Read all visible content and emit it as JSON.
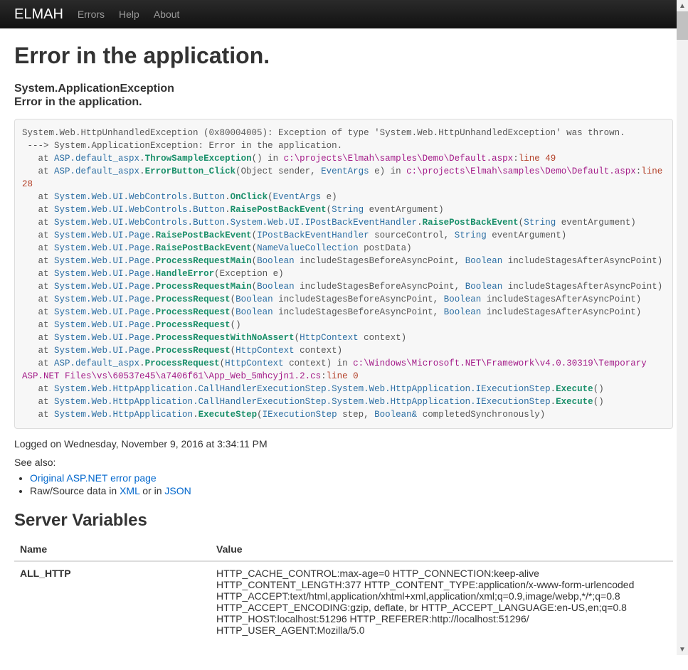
{
  "nav": {
    "brand": "ELMAH",
    "links": [
      "Errors",
      "Help",
      "About"
    ]
  },
  "title": "Error in the application.",
  "exception_type": "System.ApplicationException",
  "exception_msg": "Error in the application.",
  "stack": {
    "l0": "System.Web.HttpUnhandledException (0x80004005): Exception of type 'System.Web.HttpUnhandledException' was thrown.\n ---> System.ApplicationException: Error in the application.",
    "f1": {
      "pre": "   at ",
      "type": "ASP.default_aspx",
      "method": "ThrowSampleException",
      "args": "() in ",
      "file": "c:\\projects\\Elmah\\samples\\Demo\\Default.aspx",
      "line": "line 49"
    },
    "f2": {
      "pre": "   at ",
      "type": "ASP.default_aspx",
      "method": "ErrorButton_Click",
      "args": "(Object sender, ",
      "kw1": "EventArgs",
      "args2": " e) in ",
      "file": "c:\\projects\\Elmah\\samples\\Demo\\Default.aspx",
      "line": "line 28"
    },
    "f3": {
      "pre": "   at ",
      "type": "System.Web.UI.WebControls.Button",
      "method": "OnClick",
      "args": "(",
      "kw1": "EventArgs",
      "args2": " e)"
    },
    "f4": {
      "pre": "   at ",
      "type": "System.Web.UI.WebControls.Button",
      "method": "RaisePostBackEvent",
      "args": "(",
      "kw1": "String",
      "args2": " eventArgument)"
    },
    "f5": {
      "pre": "   at ",
      "type": "System.Web.UI.WebControls.Button.System.Web.UI.IPostBackEventHandler",
      "method": "RaisePostBackEvent",
      "args": "(",
      "kw1": "String",
      "args2": " eventArgument)"
    },
    "f6": {
      "pre": "   at ",
      "type": "System.Web.UI.Page",
      "method": "RaisePostBackEvent",
      "args": "(",
      "kw1": "IPostBackEventHandler",
      "args2": " sourceControl, ",
      "kw2": "String",
      "args3": " eventArgument)"
    },
    "f7": {
      "pre": "   at ",
      "type": "System.Web.UI.Page",
      "method": "RaisePostBackEvent",
      "args": "(",
      "kw1": "NameValueCollection",
      "args2": " postData)"
    },
    "f8": {
      "pre": "   at ",
      "type": "System.Web.UI.Page",
      "method": "ProcessRequestMain",
      "args": "(",
      "kw1": "Boolean",
      "args2": " includeStagesBeforeAsyncPoint, ",
      "kw2": "Boolean",
      "args3": " includeStagesAfterAsyncPoint)"
    },
    "f9": {
      "pre": "   at ",
      "type": "System.Web.UI.Page",
      "method": "HandleError",
      "args": "(Exception e)"
    },
    "f10": {
      "pre": "   at ",
      "type": "System.Web.UI.Page",
      "method": "ProcessRequestMain",
      "args": "(",
      "kw1": "Boolean",
      "args2": " includeStagesBeforeAsyncPoint, ",
      "kw2": "Boolean",
      "args3": " includeStagesAfterAsyncPoint)"
    },
    "f11": {
      "pre": "   at ",
      "type": "System.Web.UI.Page",
      "method": "ProcessRequest",
      "args": "(",
      "kw1": "Boolean",
      "args2": " includeStagesBeforeAsyncPoint, ",
      "kw2": "Boolean",
      "args3": " includeStagesAfterAsyncPoint)"
    },
    "f12": {
      "pre": "   at ",
      "type": "System.Web.UI.Page",
      "method": "ProcessRequest",
      "args": "(",
      "kw1": "Boolean",
      "args2": " includeStagesBeforeAsyncPoint, ",
      "kw2": "Boolean",
      "args3": " includeStagesAfterAsyncPoint)"
    },
    "f13": {
      "pre": "   at ",
      "type": "System.Web.UI.Page",
      "method": "ProcessRequest",
      "args": "()"
    },
    "f14": {
      "pre": "   at ",
      "type": "System.Web.UI.Page",
      "method": "ProcessRequestWithNoAssert",
      "args": "(",
      "kw1": "HttpContext",
      "args2": " context)"
    },
    "f15": {
      "pre": "   at ",
      "type": "System.Web.UI.Page",
      "method": "ProcessRequest",
      "args": "(",
      "kw1": "HttpContext",
      "args2": " context)"
    },
    "f16": {
      "pre": "   at ",
      "type": "ASP.default_aspx",
      "method": "ProcessRequest",
      "args": "(",
      "kw1": "HttpContext",
      "args2": " context) in ",
      "file": "c:\\Windows\\Microsoft.NET\\Framework\\v4.0.30319\\Temporary ASP.NET Files\\vs\\60537e45\\a7406f61\\App_Web_5mhcyjn1.2.cs",
      "line": "line 0"
    },
    "f17": {
      "pre": "   at ",
      "type": "System.Web.HttpApplication.CallHandlerExecutionStep.System.Web.HttpApplication.IExecutionStep",
      "method": "Execute",
      "args": "()"
    },
    "f18": {
      "pre": "   at ",
      "type": "System.Web.HttpApplication.CallHandlerExecutionStep.System.Web.HttpApplication.IExecutionStep",
      "method": "Execute",
      "args": "()"
    },
    "f19": {
      "pre": "   at ",
      "type": "System.Web.HttpApplication",
      "method": "ExecuteStep",
      "args": "(",
      "kw1": "IExecutionStep",
      "args2": " step, ",
      "kw2": "Boolean&",
      "args3": " completedSynchronously)"
    }
  },
  "logged_on": "Logged on Wednesday, November 9, 2016 at 3:34:11 PM",
  "seealso": "See also:",
  "links": {
    "original": "Original ASP.NET error page",
    "raw_prefix": "Raw/Source data in ",
    "xml": "XML",
    "or_in": " or in ",
    "json": "JSON"
  },
  "server_vars": {
    "heading": "Server Variables",
    "cols": {
      "name": "Name",
      "value": "Value"
    },
    "rows": [
      {
        "name": "ALL_HTTP",
        "value": "HTTP_CACHE_CONTROL:max-age=0 HTTP_CONNECTION:keep-alive HTTP_CONTENT_LENGTH:377 HTTP_CONTENT_TYPE:application/x-www-form-urlencoded HTTP_ACCEPT:text/html,application/xhtml+xml,application/xml;q=0.9,image/webp,*/*;q=0.8 HTTP_ACCEPT_ENCODING:gzip, deflate, br HTTP_ACCEPT_LANGUAGE:en-US,en;q=0.8 HTTP_HOST:localhost:51296 HTTP_REFERER:http://localhost:51296/ HTTP_USER_AGENT:Mozilla/5.0"
      }
    ]
  }
}
